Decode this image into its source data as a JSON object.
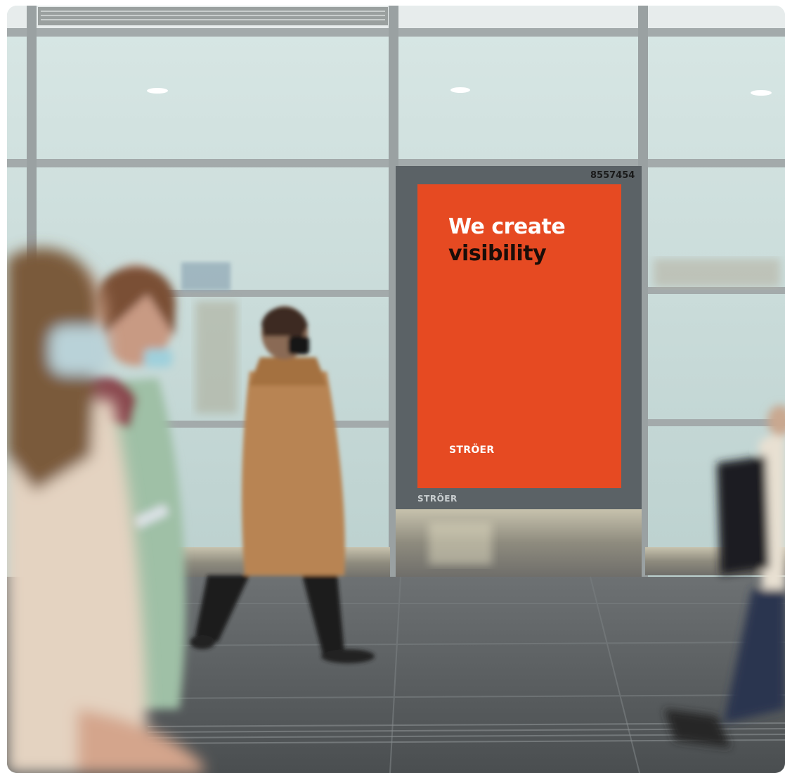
{
  "scene": {
    "description_kind": "photo",
    "poster": {
      "headline_line1": "We create",
      "headline_line2": "visibility",
      "brand": "STRÖER",
      "background_color": "#e64a22"
    },
    "display_frame": {
      "brand": "STRÖER",
      "panel_id": "8557454",
      "frame_color": "#5b6266"
    },
    "colors": {
      "glass": "#cfe0df",
      "mullion": "#9ea6a8",
      "floor": "#585d60",
      "coat": "#b88452",
      "hoodie": "#9fc0a6"
    }
  }
}
